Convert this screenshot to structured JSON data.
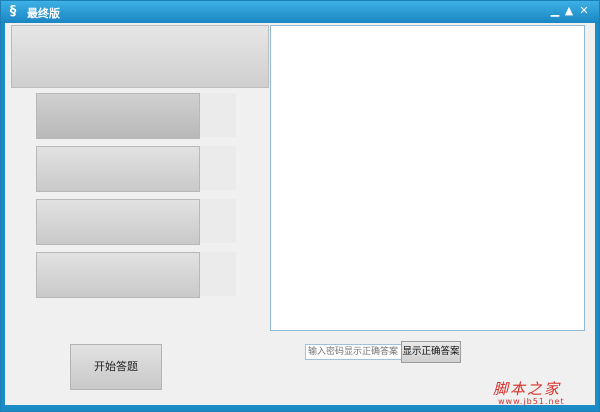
{
  "window": {
    "title": "最终版",
    "app_icon": "app-logo-icon"
  },
  "titlebar_buttons": {
    "minimize": "▁",
    "maximize": "▲",
    "close": "✕"
  },
  "left_panel": {
    "top_display": "",
    "options": [
      "",
      "",
      "",
      ""
    ]
  },
  "start_button": {
    "label": "开始答题"
  },
  "right_panel": {
    "output_text": "",
    "password_placeholder": "输入密码显示正确答案",
    "show_answer_label": "显示正确答案"
  },
  "watermark": {
    "main": "脚本之家",
    "sub": "www.jb51.net"
  },
  "colors": {
    "titlebar": "#1a86c2",
    "watermark": "#d9312a"
  }
}
